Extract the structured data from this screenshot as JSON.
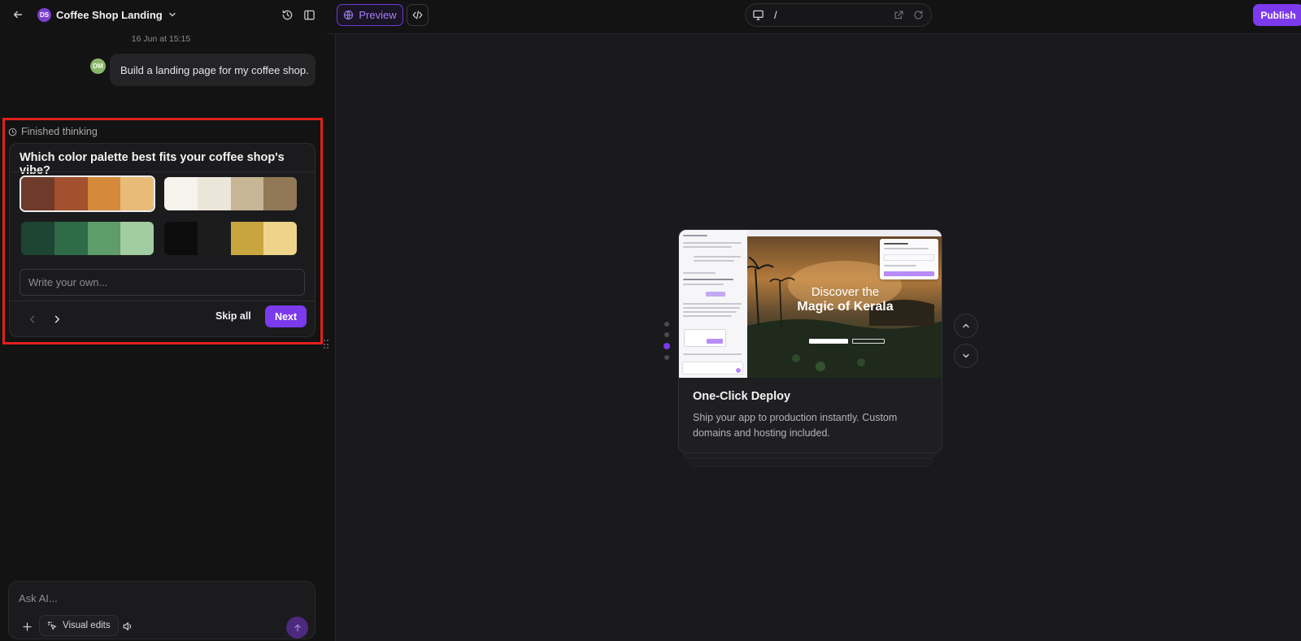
{
  "app": {
    "project_name": "Coffee Shop Landing",
    "project_initials": "DS"
  },
  "chat": {
    "timestamp": "16 Jun at 15:15",
    "user_initials": "DM",
    "user_message": "Build a landing page for my coffee shop.",
    "thinking_status": "Finished thinking"
  },
  "question": {
    "title": "Which color palette best fits your coffee shop's vibe?",
    "palettes": [
      {
        "colors": [
          "#6e3a2a",
          "#a2502e",
          "#d48a3a",
          "#e8bc78"
        ],
        "selected": true
      },
      {
        "colors": [
          "#f6f3ec",
          "#ece5da",
          "#c7b595",
          "#917857"
        ],
        "selected": false
      },
      {
        "colors": [
          "#1e4433",
          "#2f6b46",
          "#5e9c6a",
          "#a2cca2"
        ],
        "selected": false
      },
      {
        "colors": [
          "#0d0d0e",
          "#1c1c1d",
          "#c9a540",
          "#eed38a"
        ],
        "selected": false
      }
    ],
    "own_placeholder": "Write your own...",
    "skip_label": "Skip all",
    "next_label": "Next"
  },
  "composer": {
    "placeholder": "Ask AI...",
    "visual_edits_label": "Visual edits"
  },
  "preview_toolbar": {
    "preview_label": "Preview",
    "url_path": "/",
    "publish_label": "Publish"
  },
  "feature": {
    "title": "One-Click Deploy",
    "description": "Ship your app to production instantly. Custom domains and hosting included.",
    "headline_line1": "Discover the",
    "headline_line2": "Magic of Kerala",
    "total_slides": 4,
    "active_slide": 3
  },
  "colors": {
    "accent": "#7c3aed",
    "highlight": "#e0201c"
  }
}
